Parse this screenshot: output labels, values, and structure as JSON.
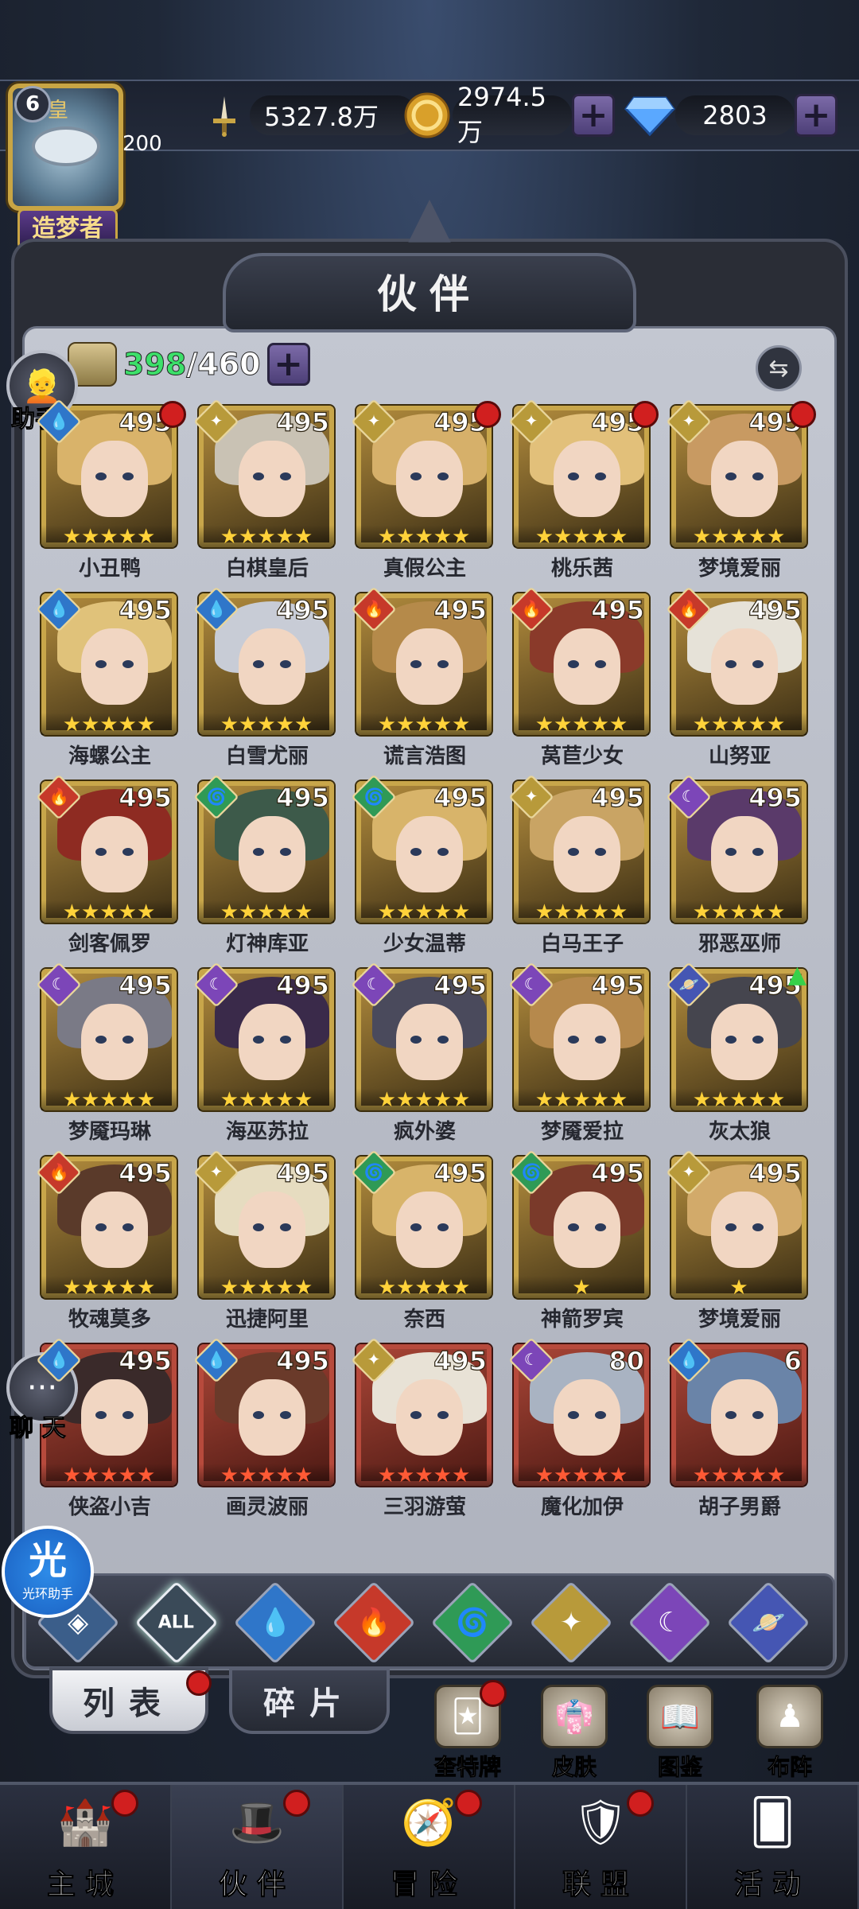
{
  "header": {
    "player_level": "6",
    "avatar_hat": "皇",
    "avatar_sub": "200",
    "title_badge": "造梦者",
    "title_dots": "◆◆◆◆◆",
    "power": "5327.8万",
    "gold": "2974.5万",
    "gems": "2803",
    "plus_symbol": "+"
  },
  "panel": {
    "title": "伙伴",
    "roster_current": "398",
    "roster_max": "/460",
    "swap_symbol": "⇆"
  },
  "side": {
    "assistant_label": "助手",
    "chat_label": "聊 天",
    "chat_symbol": "···",
    "helper_big": "光",
    "helper_small": "光环助手"
  },
  "elements": {
    "water": {
      "symbol": "💧",
      "color": "#2f76c9"
    },
    "fire": {
      "symbol": "🔥",
      "color": "#c6392a"
    },
    "wind": {
      "symbol": "🌀",
      "color": "#2f9a56"
    },
    "light": {
      "symbol": "✦",
      "color": "#b89a3a"
    },
    "dark": {
      "symbol": "☾",
      "color": "#7c46b8"
    },
    "void": {
      "symbol": "🪐",
      "color": "#4556b3"
    }
  },
  "heroes": [
    {
      "name": "小丑鸭",
      "level": "495",
      "element": "water",
      "stars": "★★★★★",
      "rank": "gold",
      "red_dot": true,
      "hair": "#d9b36a"
    },
    {
      "name": "白棋皇后",
      "level": "495",
      "element": "light",
      "stars": "★★★★★",
      "rank": "gold",
      "red_dot": false,
      "hair": "#c9c2b4"
    },
    {
      "name": "真假公主",
      "level": "495",
      "element": "light",
      "stars": "★★★★★",
      "rank": "gold",
      "red_dot": true,
      "hair": "#d6b06a"
    },
    {
      "name": "桃乐茜",
      "level": "495",
      "element": "light",
      "stars": "★★★★★",
      "rank": "gold",
      "red_dot": true,
      "hair": "#e2c07a"
    },
    {
      "name": "梦境爱丽",
      "level": "495",
      "element": "light",
      "stars": "★★★★★",
      "rank": "gold",
      "red_dot": true,
      "hair": "#c89a62"
    },
    {
      "name": "海螺公主",
      "level": "495",
      "element": "water",
      "stars": "★★★★★",
      "rank": "gold",
      "red_dot": false,
      "hair": "#e0c27a"
    },
    {
      "name": "白雪尤丽",
      "level": "495",
      "element": "water",
      "stars": "★★★★★",
      "rank": "gold",
      "red_dot": false,
      "hair": "#c8ccd6"
    },
    {
      "name": "谎言浩图",
      "level": "495",
      "element": "fire",
      "stars": "★★★★★",
      "rank": "gold",
      "red_dot": false,
      "hair": "#b58a4a"
    },
    {
      "name": "莴苣少女",
      "level": "495",
      "element": "fire",
      "stars": "★★★★★",
      "rank": "gold",
      "red_dot": false,
      "hair": "#8a3a2a"
    },
    {
      "name": "山努亚",
      "level": "495",
      "element": "fire",
      "stars": "★★★★★",
      "rank": "gold",
      "red_dot": false,
      "hair": "#e6e2d8"
    },
    {
      "name": "剑客佩罗",
      "level": "495",
      "element": "fire",
      "stars": "★★★★★",
      "rank": "gold",
      "red_dot": false,
      "hair": "#8e2b22"
    },
    {
      "name": "灯神库亚",
      "level": "495",
      "element": "wind",
      "stars": "★★★★★",
      "rank": "gold",
      "red_dot": false,
      "hair": "#3d5a4a"
    },
    {
      "name": "少女温蒂",
      "level": "495",
      "element": "wind",
      "stars": "★★★★★",
      "rank": "gold",
      "red_dot": false,
      "hair": "#d8b46a"
    },
    {
      "name": "白马王子",
      "level": "495",
      "element": "light",
      "stars": "★★★★★",
      "rank": "gold",
      "red_dot": false,
      "hair": "#c9a464"
    },
    {
      "name": "邪恶巫师",
      "level": "495",
      "element": "dark",
      "stars": "★★★★★",
      "rank": "gold",
      "red_dot": false,
      "hair": "#5a3a6a"
    },
    {
      "name": "梦魇玛琳",
      "level": "495",
      "element": "dark",
      "stars": "★★★★★",
      "rank": "gold",
      "red_dot": false,
      "hair": "#7a7a86"
    },
    {
      "name": "海巫苏拉",
      "level": "495",
      "element": "dark",
      "stars": "★★★★★",
      "rank": "gold",
      "red_dot": false,
      "hair": "#3a2a4a"
    },
    {
      "name": "疯外婆",
      "level": "495",
      "element": "dark",
      "stars": "★★★★★",
      "rank": "gold",
      "red_dot": false,
      "hair": "#4a4a5c"
    },
    {
      "name": "梦魇爱拉",
      "level": "495",
      "element": "dark",
      "stars": "★★★★★",
      "rank": "gold",
      "red_dot": false,
      "hair": "#b6894c"
    },
    {
      "name": "灰太狼",
      "level": "495",
      "element": "void",
      "stars": "★★★★★",
      "rank": "gold",
      "red_dot": false,
      "up_arrow": true,
      "hair": "#45454e"
    },
    {
      "name": "牧魂莫多",
      "level": "495",
      "element": "fire",
      "stars": "★★★★★",
      "rank": "gold",
      "red_dot": false,
      "hair": "#5a3a2a"
    },
    {
      "name": "迅捷阿里",
      "level": "495",
      "element": "light",
      "stars": "★★★★★",
      "rank": "gold",
      "red_dot": false,
      "hair": "#e6dcc0"
    },
    {
      "name": "奈西",
      "level": "495",
      "element": "wind",
      "stars": "★★★★★",
      "rank": "gold",
      "red_dot": false,
      "hair": "#d8b46a"
    },
    {
      "name": "神箭罗宾",
      "level": "495",
      "element": "wind",
      "stars": "★",
      "rank": "gold",
      "red_dot": false,
      "hair": "#7a3a2a"
    },
    {
      "name": "梦境爱丽",
      "level": "495",
      "element": "light",
      "stars": "★",
      "rank": "gold",
      "red_dot": false,
      "hair": "#d2aa6a"
    },
    {
      "name": "侠盗小吉",
      "level": "495",
      "element": "water",
      "stars": "★★★★★",
      "rank": "red",
      "red_dot": false,
      "hair": "#3a2a2a"
    },
    {
      "name": "画灵波丽",
      "level": "495",
      "element": "water",
      "stars": "★★★★★",
      "rank": "red",
      "red_dot": false,
      "hair": "#6a3a2a"
    },
    {
      "name": "三羽游萤",
      "level": "495",
      "element": "light",
      "stars": "★★★★★",
      "rank": "red",
      "red_dot": false,
      "hair": "#e8e2d6"
    },
    {
      "name": "魔化加伊",
      "level": "80",
      "element": "dark",
      "stars": "★★★★★",
      "rank": "red",
      "red_dot": false,
      "hair": "#a9b3c2"
    },
    {
      "name": "胡子男爵",
      "level": "6",
      "element": "water",
      "stars": "★★★★★",
      "rank": "red",
      "red_dot": false,
      "hair": "#6a84a8"
    }
  ],
  "filters": [
    {
      "id": "void",
      "symbol": "◈",
      "color": "#3b5e8a"
    },
    {
      "id": "all",
      "symbol": "ALL",
      "color": "#3a4a58"
    },
    {
      "id": "water",
      "symbol": "💧",
      "color": "#2f76c9"
    },
    {
      "id": "fire",
      "symbol": "🔥",
      "color": "#c6392a"
    },
    {
      "id": "wind",
      "symbol": "🌀",
      "color": "#2f9a56"
    },
    {
      "id": "light",
      "symbol": "✦",
      "color": "#b89a3a"
    },
    {
      "id": "dark",
      "symbol": "☾",
      "color": "#7c46b8"
    },
    {
      "id": "void2",
      "symbol": "🪐",
      "color": "#4556b3"
    }
  ],
  "tabs": {
    "list": "列表",
    "fragments": "碎片"
  },
  "shortcuts": [
    {
      "label": "奎特牌",
      "icon": "🃏",
      "red_dot": true
    },
    {
      "label": "皮肤",
      "icon": "👘",
      "red_dot": false
    },
    {
      "label": "图鉴",
      "icon": "📖",
      "red_dot": false
    },
    {
      "label": "布阵",
      "icon": "♟",
      "red_dot": false
    }
  ],
  "nav": [
    {
      "label": "主城",
      "icon": "🏰",
      "red_dot": true,
      "active": false
    },
    {
      "label": "伙伴",
      "icon": "🎩",
      "red_dot": true,
      "active": true
    },
    {
      "label": "冒险",
      "icon": "🧭",
      "red_dot": true,
      "active": false
    },
    {
      "label": "联盟",
      "icon": "🛡",
      "red_dot": true,
      "active": false
    },
    {
      "label": "活动",
      "icon": "🂠",
      "red_dot": false,
      "active": false
    }
  ]
}
